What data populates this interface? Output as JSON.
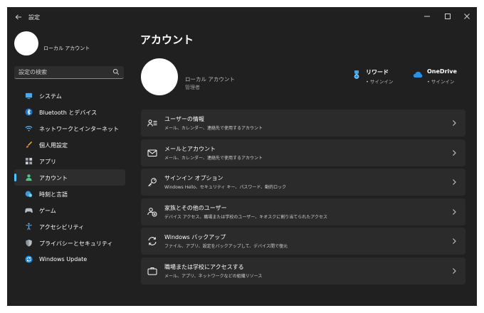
{
  "app": {
    "title": "設定"
  },
  "sidebar_profile": {
    "name": "ローカル アカウント"
  },
  "search": {
    "placeholder": "設定の検索"
  },
  "nav": [
    {
      "label": "システム",
      "icon": "monitor-icon"
    },
    {
      "label": "Bluetooth とデバイス",
      "icon": "bluetooth-icon"
    },
    {
      "label": "ネットワークとインターネット",
      "icon": "wifi-icon"
    },
    {
      "label": "個人用設定",
      "icon": "brush-icon"
    },
    {
      "label": "アプリ",
      "icon": "apps-icon"
    },
    {
      "label": "アカウント",
      "icon": "person-icon",
      "active": true
    },
    {
      "label": "時刻と言語",
      "icon": "globe-clock-icon"
    },
    {
      "label": "ゲーム",
      "icon": "gamepad-icon"
    },
    {
      "label": "アクセシビリティ",
      "icon": "accessibility-icon"
    },
    {
      "label": "プライバシーとセキュリティ",
      "icon": "shield-icon"
    },
    {
      "label": "Windows Update",
      "icon": "update-icon"
    }
  ],
  "main": {
    "title": "アカウント",
    "profile": {
      "name": "ローカル アカウント",
      "role": "管理者"
    },
    "services": [
      {
        "name": "リワード",
        "status": "• サインイン",
        "icon": "rewards-icon"
      },
      {
        "name": "OneDrive",
        "status": "• サインイン",
        "icon": "onedrive-icon"
      }
    ],
    "cards": [
      {
        "title": "ユーザーの情報",
        "desc": "メール、カレンダー、連絡先で使用するアカウント",
        "icon": "user-info-icon"
      },
      {
        "title": "メールとアカウント",
        "desc": "メール、カレンダー、連絡先で使用するアカウント",
        "icon": "mail-icon"
      },
      {
        "title": "サインイン オプション",
        "desc": "Windows Hello、セキュリティ キー、パスワード、動的ロック",
        "icon": "key-icon"
      },
      {
        "title": "家族とその他のユーザー",
        "desc": "デバイス アクセス、職場または学校のユーザー、キオスクに割り当てられたアクセス",
        "icon": "family-icon"
      },
      {
        "title": "Windows バックアップ",
        "desc": "ファイル、アプリ、設定をバックアップして、デバイス間で復元",
        "icon": "backup-icon"
      },
      {
        "title": "職場または学校にアクセスする",
        "desc": "メール、アプリ、ネットワークなどの組織リソース",
        "icon": "briefcase-icon"
      }
    ]
  },
  "colors": {
    "accent": "#4cc2ff",
    "background": "#202020",
    "card": "#2b2b2b"
  }
}
